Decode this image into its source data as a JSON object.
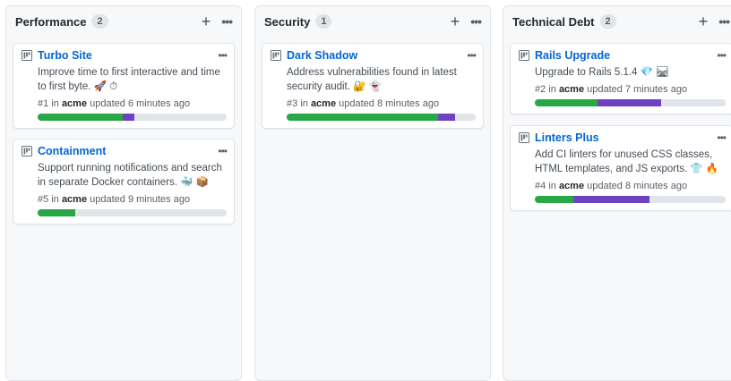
{
  "columns": [
    {
      "title": "Performance",
      "count": "2",
      "add_icon": "plus-icon",
      "menu_icon": "kebab-icon",
      "cards": [
        {
          "title": "Turbo Site",
          "description": "Improve time to first interactive and time to first byte. 🚀 ⏱",
          "number": "#1",
          "in": "in",
          "repo": "acme",
          "updated": "updated 6 minutes ago",
          "progress": {
            "done": 0.45,
            "in_progress": 0.06
          }
        },
        {
          "title": "Containment",
          "description": "Support running notifications and search in separate Docker containers. 🐳 📦",
          "number": "#5",
          "in": "in",
          "repo": "acme",
          "updated": "updated 9 minutes ago",
          "progress": {
            "done": 0.2,
            "in_progress": 0.0
          }
        }
      ]
    },
    {
      "title": "Security",
      "count": "1",
      "add_icon": "plus-icon",
      "menu_icon": "kebab-icon",
      "cards": [
        {
          "title": "Dark Shadow",
          "description": "Address vulnerabilities found in latest security audit. 🔐 👻",
          "number": "#3",
          "in": "in",
          "repo": "acme",
          "updated": "updated 8 minutes ago",
          "progress": {
            "done": 0.8,
            "in_progress": 0.09
          }
        }
      ]
    },
    {
      "title": "Technical Debt",
      "count": "2",
      "add_icon": "plus-icon",
      "menu_icon": "kebab-icon",
      "cards": [
        {
          "title": "Rails Upgrade",
          "description": "Upgrade to Rails 5.1.4 💎 🛤",
          "number": "#2",
          "in": "in",
          "repo": "acme",
          "updated": "updated 7 minutes ago",
          "progress": {
            "done": 0.33,
            "in_progress": 0.33
          }
        },
        {
          "title": "Linters Plus",
          "description": "Add CI linters for unused CSS classes, HTML templates, and JS exports. 👕 🔥",
          "number": "#4",
          "in": "in",
          "repo": "acme",
          "updated": "updated 8 minutes ago",
          "progress": {
            "done": 0.2,
            "in_progress": 0.4
          }
        }
      ]
    }
  ],
  "colors": {
    "link": "#0366d6",
    "done": "#28a745",
    "in_progress": "#6f42c1",
    "track": "#e1e4e8"
  }
}
